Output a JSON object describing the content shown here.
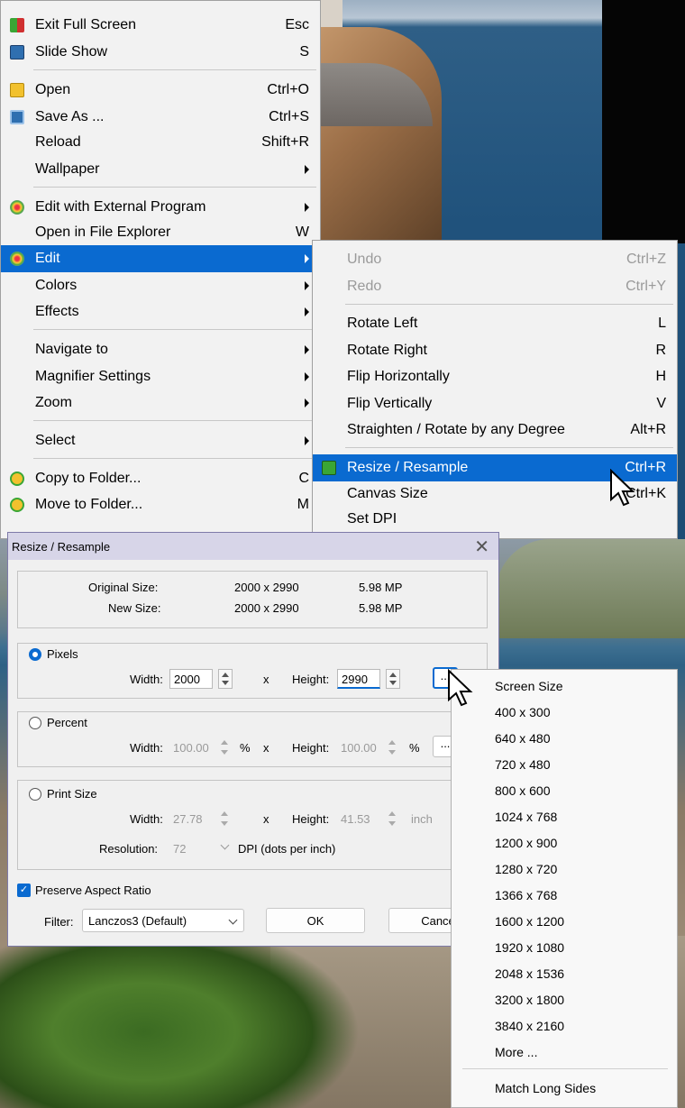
{
  "context_menu": {
    "items": [
      {
        "label": "Exit Full Screen",
        "shortcut": "Esc"
      },
      {
        "label": "Slide Show",
        "shortcut": "S"
      },
      {
        "label": "Open",
        "shortcut": "Ctrl+O"
      },
      {
        "label": "Save As ...",
        "shortcut": "Ctrl+S"
      },
      {
        "label": "Reload",
        "shortcut": "Shift+R"
      },
      {
        "label": "Wallpaper",
        "shortcut": ""
      },
      {
        "label": "Edit with External Program",
        "shortcut": ""
      },
      {
        "label": "Open in File Explorer",
        "shortcut": "W"
      },
      {
        "label": "Edit",
        "shortcut": ""
      },
      {
        "label": "Colors",
        "shortcut": ""
      },
      {
        "label": "Effects",
        "shortcut": ""
      },
      {
        "label": "Navigate to",
        "shortcut": ""
      },
      {
        "label": "Magnifier Settings",
        "shortcut": ""
      },
      {
        "label": "Zoom",
        "shortcut": ""
      },
      {
        "label": "Select",
        "shortcut": ""
      },
      {
        "label": "Copy to Folder...",
        "shortcut": "C"
      },
      {
        "label": "Move to Folder...",
        "shortcut": "M"
      }
    ]
  },
  "edit_submenu": {
    "items": [
      {
        "label": "Undo",
        "shortcut": "Ctrl+Z"
      },
      {
        "label": "Redo",
        "shortcut": "Ctrl+Y"
      },
      {
        "label": "Rotate Left",
        "shortcut": "L"
      },
      {
        "label": "Rotate Right",
        "shortcut": "R"
      },
      {
        "label": "Flip Horizontally",
        "shortcut": "H"
      },
      {
        "label": "Flip Vertically",
        "shortcut": "V"
      },
      {
        "label": "Straighten / Rotate by any Degree",
        "shortcut": "Alt+R"
      },
      {
        "label": "Resize / Resample",
        "shortcut": "Ctrl+R"
      },
      {
        "label": "Canvas Size",
        "shortcut": "Ctrl+K"
      },
      {
        "label": "Set DPI",
        "shortcut": ""
      }
    ]
  },
  "dialog": {
    "title": "Resize / Resample",
    "info": {
      "original_label": "Original Size:",
      "original_dims": "2000 x 2990",
      "original_mp": "5.98 MP",
      "new_label": "New Size:",
      "new_dims": "2000 x 2990",
      "new_mp": "5.98 MP"
    },
    "pixels": {
      "label": "Pixels",
      "width_label": "Width:",
      "width": "2000",
      "x": "x",
      "height_label": "Height:",
      "height": "2990",
      "dots": "..."
    },
    "percent": {
      "label": "Percent",
      "width_label": "Width:",
      "width": "100.00",
      "pct": "%",
      "x": "x",
      "height_label": "Height:",
      "height": "100.00",
      "pct2": "%",
      "dots": "..."
    },
    "print": {
      "label": "Print Size",
      "width_label": "Width:",
      "width": "27.78",
      "x": "x",
      "height_label": "Height:",
      "height": "41.53",
      "unit": "inch",
      "resolution_label": "Resolution:",
      "resolution": "72",
      "dpi_label": "DPI (dots per inch)"
    },
    "preserve_label": "Preserve Aspect Ratio",
    "filter_label": "Filter:",
    "filter_value": "Lanczos3 (Default)",
    "ok_label": "OK",
    "cancel_label": "Cance"
  },
  "presets": {
    "items": [
      "Screen Size",
      "400 x 300",
      "640 x 480",
      "720 x 480",
      "800 x 600",
      "1024 x 768",
      "1200 x 900",
      "1280 x 720",
      "1366 x 768",
      "1600 x 1200",
      "1920 x 1080",
      "2048 x 1536",
      "3200 x 1800",
      "3840 x 2160",
      "More ..."
    ],
    "footer": "Match Long Sides"
  },
  "colors": {
    "highlight": "#0a6ad0",
    "menu_bg": "#f2f2f2"
  }
}
